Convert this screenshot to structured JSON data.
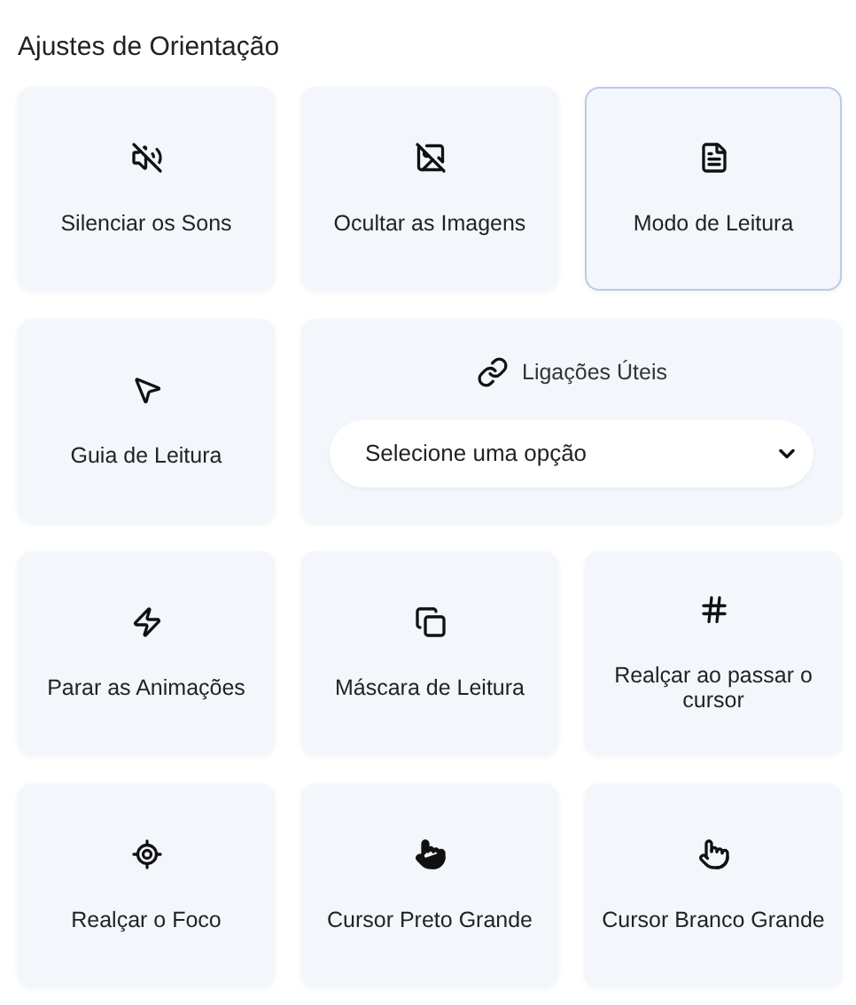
{
  "title": "Ajustes de Orientação",
  "tiles": [
    {
      "kind": "toggle",
      "label": "Silenciar os Sons",
      "selected": false
    },
    {
      "kind": "toggle",
      "label": "Ocultar as Imagens",
      "selected": false
    },
    {
      "kind": "toggle",
      "label": "Modo de Leitura",
      "selected": true
    },
    {
      "kind": "toggle",
      "label": "Guia de Leitura",
      "selected": false
    },
    {
      "kind": "select",
      "label": "Ligações Úteis",
      "value": "Selecione uma opção"
    },
    {
      "kind": "toggle",
      "label": "Parar as Animações",
      "selected": false
    },
    {
      "kind": "toggle",
      "label": "Máscara de Leitura",
      "selected": false
    },
    {
      "kind": "toggle",
      "label": "Realçar ao passar o cursor",
      "selected": false
    },
    {
      "kind": "toggle",
      "label": "Realçar o Foco",
      "selected": false
    },
    {
      "kind": "toggle",
      "label": "Cursor Preto Grande",
      "selected": false
    },
    {
      "kind": "toggle",
      "label": "Cursor Branco Grande",
      "selected": false
    }
  ]
}
